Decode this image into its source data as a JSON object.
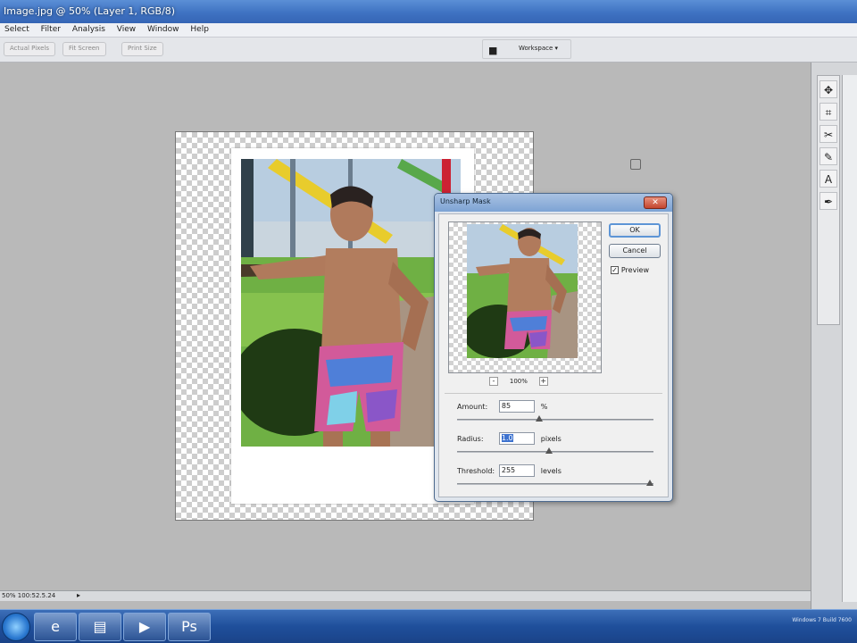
{
  "app": {
    "title": "Image.jpg @ 50% (Layer 1, RGB/8)"
  },
  "menu": [
    "Select",
    "Filter",
    "Analysis",
    "View",
    "Window",
    "Help"
  ],
  "options_bar": {
    "buttons": [
      "Actual Pixels",
      "Fit Screen",
      "Print Size"
    ],
    "workspace_label": "Workspace ▾"
  },
  "dialog": {
    "title": "Unsharp Mask",
    "ok_label": "OK",
    "cancel_label": "Cancel",
    "preview_label": "Preview",
    "preview_checked": true,
    "zoom_minus": "-",
    "zoom_plus": "+",
    "zoom_value": "100%",
    "amount": {
      "label": "Amount:",
      "value": "85",
      "unit": "%",
      "level": 0.42
    },
    "radius": {
      "label": "Radius:",
      "value": "1.0",
      "unit": "pixels",
      "level": 0.47
    },
    "threshold": {
      "label": "Threshold:",
      "value": "255",
      "unit": "levels",
      "level": 1.0
    }
  },
  "status_bar": {
    "zoom": "50% 100:52.5.24",
    "arrow": "▸"
  },
  "taskbar": {
    "buttons": [
      "internet-explorer",
      "windows-explorer",
      "media-player",
      "photoshop"
    ],
    "tray_text": "Windows 7 Build 7600"
  },
  "tools": [
    "move-tool",
    "crop-tool",
    "heal-tool",
    "brush-tool",
    "text-tool",
    "pen-tool"
  ],
  "colors": {
    "title_bar": "#3f72c2",
    "workspace": "#b9b9b9",
    "dialog_title": "#7da3d4",
    "taskbar": "#1f4f9b"
  }
}
